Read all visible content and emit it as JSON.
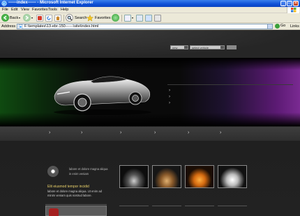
{
  "window": {
    "title": "------index------ - Microsoft Internet Explorer",
    "controls": [
      "minimize",
      "maximize",
      "close"
    ]
  },
  "menu": {
    "items": [
      "File",
      "Edit",
      "View",
      "Favorites",
      "Tools",
      "Help"
    ]
  },
  "toolbar": {
    "back_label": "Back",
    "search_label": "Search",
    "favorites_label": "Favorites"
  },
  "address": {
    "label": "Address",
    "url": "F:\\templates\\13-ebr-150------\\site\\index.html",
    "go_label": "Go",
    "links_label": "Links"
  },
  "site": {
    "lang_select": "new",
    "vehicle_select": "select vehicle",
    "hero_links": [
      "›",
      "›",
      "›"
    ],
    "nav_items": [
      "›",
      "›",
      "›",
      "›",
      "›",
      "›"
    ],
    "feature_text": "labore et dolore magna aliqua in enim veniam",
    "feature_title": "Elit eiusmod tempor incidid",
    "feature_desc": "labore et dolore magna aliqua. Ut enim ad minim veniam quis nostrud labore."
  },
  "colors": {
    "xp_blue": "#0d4fd6",
    "chrome": "#ece9d8",
    "page_bg": "#222222",
    "accent_gold": "#e8d06a",
    "hero_green": "#0f4a10",
    "hero_purple": "#7a2a92"
  }
}
